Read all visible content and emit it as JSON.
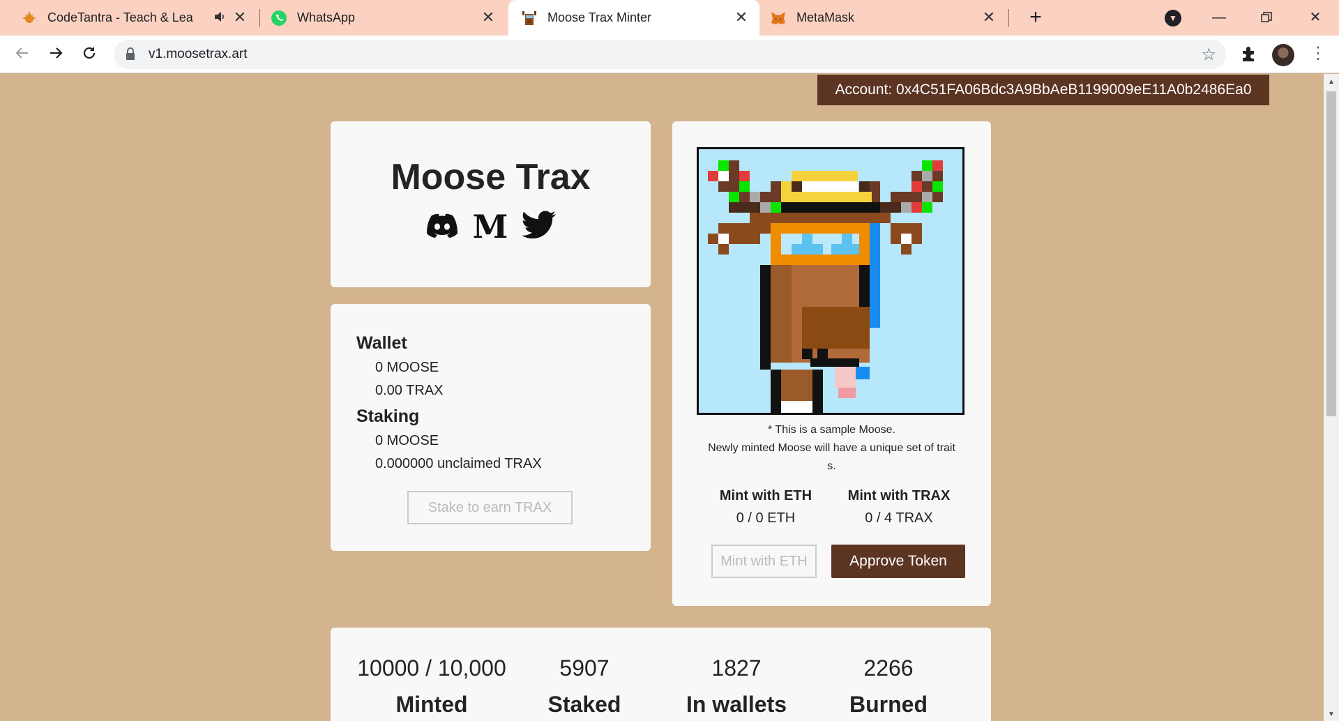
{
  "browser": {
    "tabs": [
      {
        "title": "CodeTantra - Teach & Learn /",
        "icon": "codetantra-icon"
      },
      {
        "title": "WhatsApp",
        "icon": "whatsapp-icon"
      },
      {
        "title": "Moose Trax Minter",
        "icon": "moose-icon"
      },
      {
        "title": "MetaMask",
        "icon": "metamask-icon"
      }
    ],
    "url": "v1.moosetrax.art"
  },
  "page": {
    "account_label": "Account: 0x4C51FA06Bdc3A9BbAeB1199009eE11A0b2486Ea0",
    "title": "Moose Trax",
    "wallet": {
      "heading": "Wallet",
      "moose": "0 MOOSE",
      "trax": "0.00 TRAX"
    },
    "staking": {
      "heading": "Staking",
      "moose": "0 MOOSE",
      "unclaimed": "0.000000 unclaimed TRAX",
      "stake_button": "Stake to earn TRAX"
    },
    "sample": {
      "caption_line1": "* This is a sample Moose.",
      "caption_line2": "Newly minted Moose will have a unique set of trait",
      "caption_line3": "s."
    },
    "mint": {
      "eth_heading": "Mint with ETH",
      "eth_value": "0 / 0 ETH",
      "trax_heading": "Mint with TRAX",
      "trax_value": "0 / 4 TRAX",
      "mint_eth_button": "Mint with ETH",
      "approve_button": "Approve Token"
    },
    "stats": [
      {
        "value": "10000 / 10,000",
        "label": "Minted"
      },
      {
        "value": "5907",
        "label": "Staked"
      },
      {
        "value": "1827",
        "label": "In wallets"
      },
      {
        "value": "2266",
        "label": "Burned"
      }
    ]
  },
  "colors": {
    "page_bg": "#d4b48e",
    "accent": "#5c3422",
    "card_bg": "#f8f8f8",
    "nft_bg": "#b7e7fb"
  }
}
